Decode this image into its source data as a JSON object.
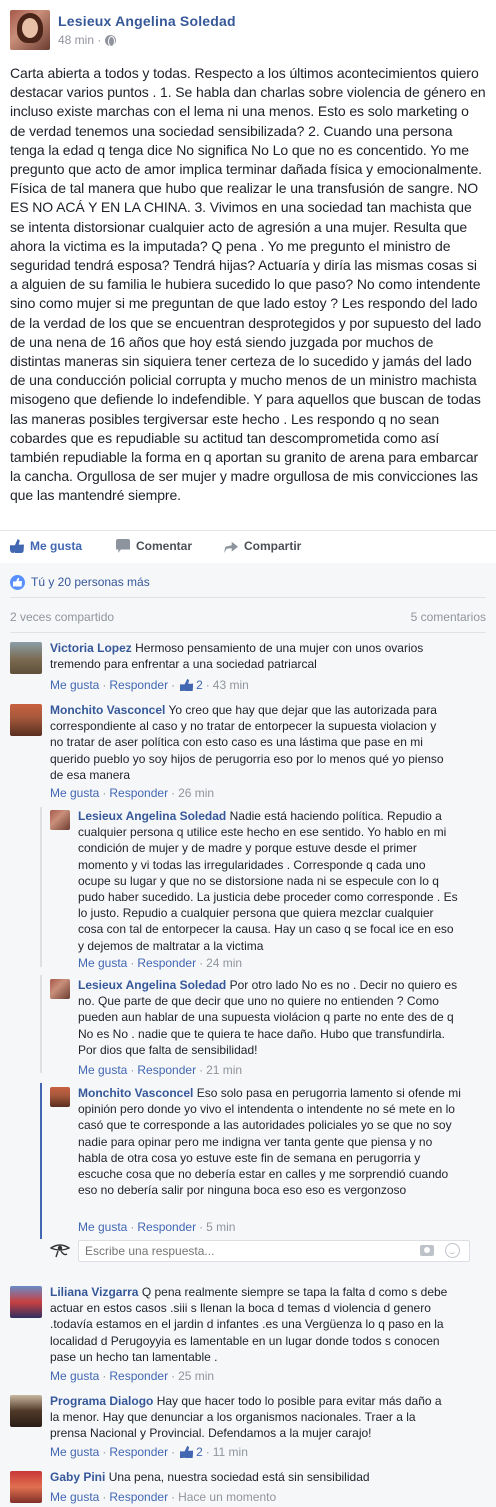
{
  "post": {
    "author": "Lesieux Angelina Soledad",
    "time": "48 min ·",
    "text": "Carta abierta a todos y todas. Respecto a los últimos acontecimientos quiero destacar varios puntos . 1. Se habla dan charlas sobre violencia de género en incluso existe marchas con el lema ni una menos. Esto es solo marketing o de verdad tenemos una sociedad sensibilizada? 2. Cuando una persona tenga la edad q tenga dice No significa No Lo que no es concentido. Yo me pregunto que acto de amor implica terminar dañada física y emocionalmente. Física de tal manera que hubo que realizar le una transfusión de sangre. NO ES NO ACÁ Y EN LA CHINA. 3. Vivimos en una sociedad tan machista que se intenta distorsionar cualquier acto de agresión a una mujer. Resulta que ahora la victima es la imputada? Q pena . Yo me pregunto el ministro de seguridad tendrá esposa? Tendrá hijas? Actuaría y diría las mismas cosas si a alguien de su familia le hubiera sucedido lo que paso? No como intendente sino como mujer si me preguntan de que lado estoy ? Les respondo del lado de la verdad de los que se encuentran desprotegidos y por supuesto del lado de una nena de 16 años que hoy está siendo juzgada por muchos de distintas maneras sin siquiera tener certeza de lo sucedido y jamás del lado de una conducción policial corrupta y mucho menos de un ministro machista misogeno que defiende lo indefendible. Y para aquellos que buscan de todas las maneras posibles tergiversar este hecho . Les respondo q no sean cobardes que es repudiable su actitud tan descomprometida como así también repudiable la forma en q aportan su granito de arena para embarcar la cancha. Orgullosa de ser mujer y madre orgullosa de mis convicciones las que las mantendré siempre."
  },
  "actions": {
    "like": "Me gusta",
    "comment": "Comentar",
    "share": "Compartir"
  },
  "feedback": {
    "likes": "Tú y 20 personas más",
    "shares": "2 veces compartido",
    "comments_count": "5 comentarios"
  },
  "labels": {
    "like": "Me gusta",
    "reply": "Responder",
    "sep": "·"
  },
  "comments": [
    {
      "name": "Victoria Lopez",
      "text": "Hermoso pensamiento de una mujer con unos ovarios tremendo para enfrentar a una sociedad patriarcal",
      "likes": "2",
      "time": "43 min"
    },
    {
      "name": "Monchito Vasconcel",
      "text": "Yo creo que hay que dejar que las autorizada para correspondiente al caso y no tratar de entorpecer la supuesta violacion y no tratar de aser política con esto caso es una lástima que pase en mi querido pueblo yo soy hijos de perugorria eso por lo menos qué yo pienso de esa manera",
      "time": "26 min"
    },
    {
      "name": "Liliana Vizgarra",
      "text": "Q pena realmente siempre se tapa la falta d como s debe actuar en estos casos .siii s llenan la boca d temas d violencia d genero .todavía estamos en el jardin d infantes .es una Vergüenza lo q paso en la localidad d Perugoyyia es lamentable en un lugar donde todos s conocen pase un hecho tan lamentable .",
      "time": "25 min"
    },
    {
      "name": "Programa Dialogo",
      "text": "Hay que hacer todo lo posible para evitar más daño a la menor. Hay que denunciar a los organismos nacionales. Traer a la prensa Nacional y Provincial. Defendamos a la mujer carajo!",
      "likes": "2",
      "time": "11 min"
    },
    {
      "name": "Gaby Pini",
      "text": "Una pena, nuestra sociedad está sin sensibilidad",
      "time": "Hace un momento"
    }
  ],
  "replies": [
    {
      "name": "Lesieux Angelina Soledad",
      "text": "Nadie está haciendo política. Repudio a cualquier persona q utilice este hecho en ese sentido. Yo hablo en mi condición de mujer y de madre y porque estuve desde el primer momento y vi todas las irregularidades . Corresponde q cada uno ocupe su lugar y que no se distorsione nada ni se especule con lo q pudo haber sucedido. La justicia debe proceder como corresponde . Es lo justo. Repudio a cualquier persona que quiera mezclar cualquier cosa con tal de entorpecer la causa. Hay un caso q se focal ice en eso y dejemos de maltratar a la victima",
      "time": "24 min"
    },
    {
      "name": "Lesieux Angelina Soledad",
      "text": "Por otro lado No es no . Decir no quiero es no. Que parte de que decir que uno no quiere no entienden ? Como pueden aun hablar de una supuesta violácion q parte no ente des de q No es No . nadie que te quiera te hace daño. Hubo que transfundirla. Por dios que falta de sensibilidad!",
      "time": "21 min"
    },
    {
      "name": "Monchito Vasconcel",
      "text": "Eso solo pasa en perugorria lamento si ofende mi opinión pero donde yo vivo el intendenta o intendente no sé mete en lo casó que te corresponde a las autoridades policiales yo se que no soy nadie para opinar pero me indigna ver tanta gente que piensa y no habla de otra cosa yo estuve este fin de semana en perugorria y escuche cosa que no debería estar en calles y me sorprendió cuando eso no debería salir por ninguna boca eso eso es vergonzoso",
      "time": "5 min"
    }
  ],
  "reply_box": {
    "placeholder": "Escribe una respuesta..."
  },
  "colors": {
    "link": "#365899",
    "accent": "#4267b2",
    "meta": "#90949c",
    "feedback_bg": "#f6f7f9"
  }
}
